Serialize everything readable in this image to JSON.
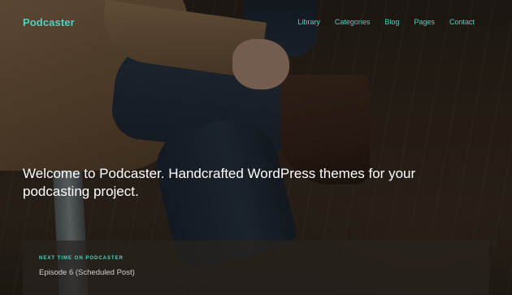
{
  "header": {
    "site_title": "Podcaster",
    "nav": [
      "Library",
      "Categories",
      "Blog",
      "Pages",
      "Contact"
    ]
  },
  "hero": {
    "headline": "Welcome to Podcaster. Handcrafted WordPress themes for your podcasting project."
  },
  "next_episode": {
    "label": "NEXT TIME ON PODCASTER",
    "title": "Episode 6 (Scheduled Post)"
  },
  "colors": {
    "accent": "#4fd1c1",
    "headline": "#ffffff",
    "panel_bg": "rgba(40,34,30,0.72)"
  }
}
